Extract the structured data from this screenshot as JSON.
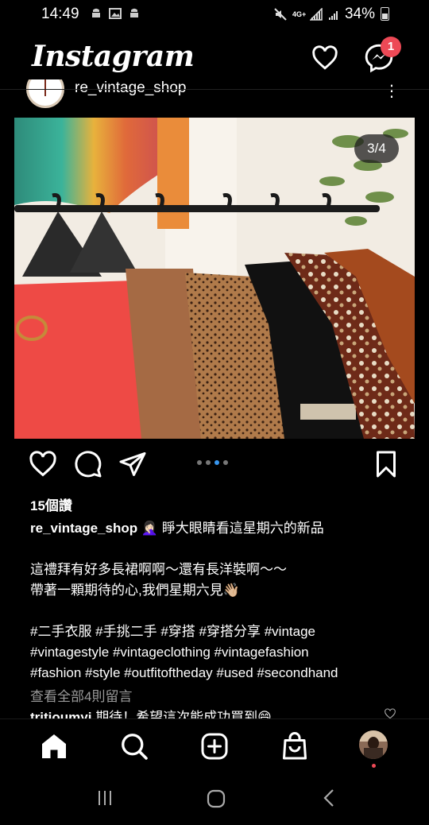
{
  "status_bar": {
    "time": "14:49",
    "network": "4G+",
    "battery": "34%",
    "icons": [
      "android-icon",
      "image-icon",
      "android-icon",
      "mute-icon",
      "signal-icon",
      "signal-icon",
      "battery-icon"
    ]
  },
  "app_bar": {
    "logo": "Instagram",
    "messages_badge": "1"
  },
  "post": {
    "username": "re_vintage_shop",
    "image_counter": "3/4",
    "carousel": {
      "count": 4,
      "active_index": 3
    },
    "likes": "15個讚",
    "caption": {
      "username": "re_vintage_shop",
      "first_line": "🤦🏻‍♀️ 睜大眼睛看這星期六的新品",
      "line2": "這禮拜有好多長裙啊啊～還有長洋裝啊～～",
      "line3": "帶著一顆期待的心,我們星期六見👋🏼",
      "hashtags_1": "#二手衣服 #手挑二手 #穿搭 #穿搭分享 #vintage",
      "hashtags_2": "#vintagestyle #vintageclothing #vintagefashion",
      "hashtags_3": "#fashion #style #outfitoftheday #used #secondhand"
    },
    "view_comments": "查看全部4則留言",
    "peek_comment": {
      "username": "tritioumyi",
      "text": "期待！希望這次能成功買到😄"
    }
  },
  "colors": {
    "background": "#000000",
    "badge": "#ed4956",
    "carousel_active": "#3897f0",
    "muted_text": "#9a9a9a"
  }
}
